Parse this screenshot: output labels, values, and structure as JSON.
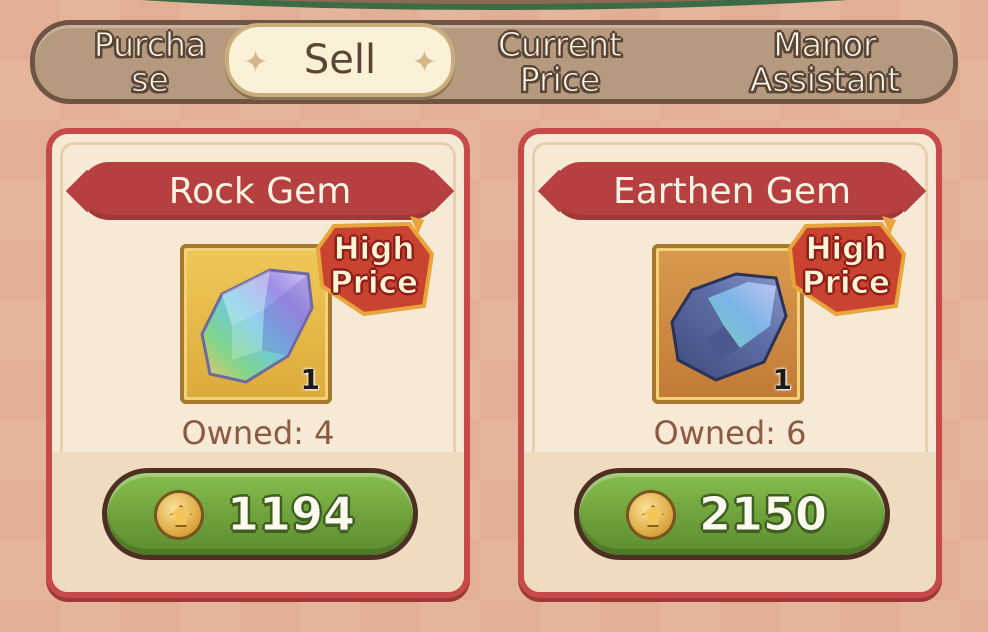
{
  "tabs": {
    "purchase": "Purcha\nse",
    "sell": "Sell",
    "current_price": "Current\nPrice",
    "manor_assistant": "Manor\nAssistant"
  },
  "items": [
    {
      "name": "Rock Gem",
      "badge_line1": "High",
      "badge_line2": "Price",
      "count": "1",
      "owned": "Owned: 4",
      "price": "1194",
      "icon": "rock-gem-icon",
      "frame_color": "#e7bb4c"
    },
    {
      "name": "Earthen Gem",
      "badge_line1": "High",
      "badge_line2": "Price",
      "count": "1",
      "owned": "Owned: 6",
      "price": "2150",
      "icon": "earthen-gem-icon",
      "frame_color": "#cf8b44"
    }
  ],
  "colors": {
    "card_border": "#c64a48",
    "button_green": "#6ea03b",
    "tab_bar": "#b59a80"
  }
}
